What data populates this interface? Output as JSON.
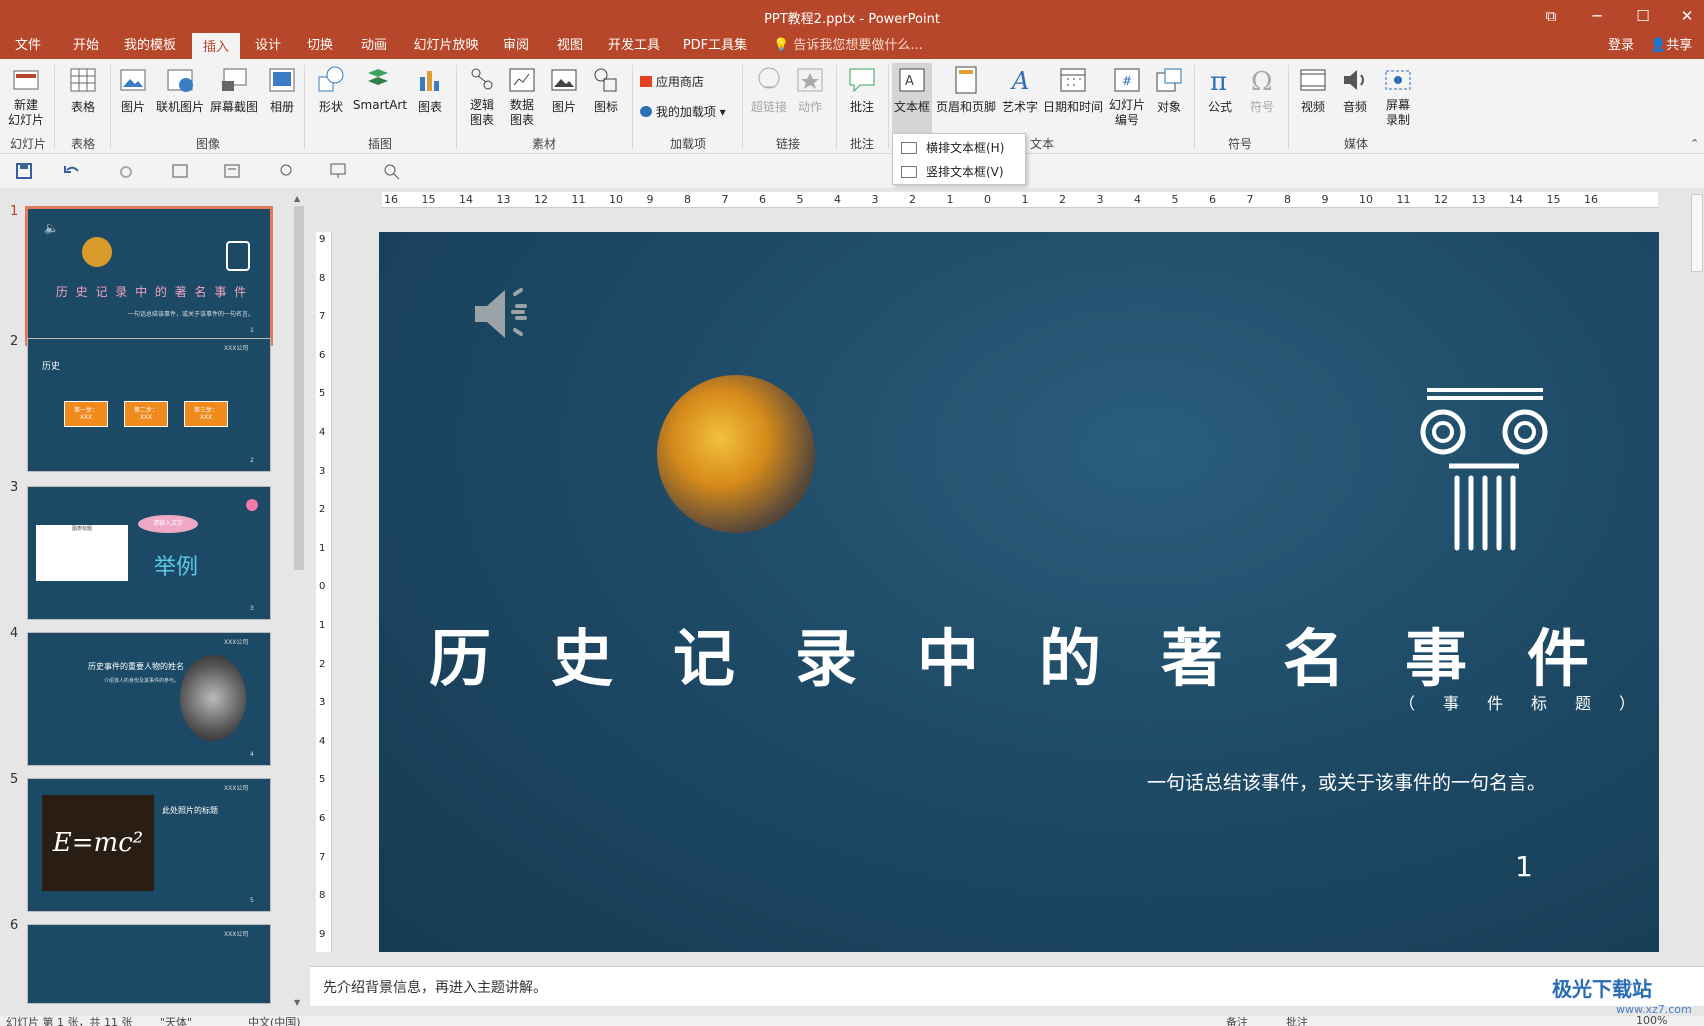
{
  "window": {
    "title": "PPT教程2.pptx - PowerPoint"
  },
  "tabs": [
    "文件",
    "开始",
    "我的模板",
    "插入",
    "设计",
    "切换",
    "动画",
    "幻灯片放映",
    "审阅",
    "视图",
    "开发工具",
    "PDF工具集"
  ],
  "active_tab": "插入",
  "tellme": "告诉我您想要做什么...",
  "account": {
    "login": "登录",
    "share": "共享"
  },
  "ribbon": {
    "buttons": {
      "new_slide": "新建\n幻灯片",
      "table": "表格",
      "picture": "图片",
      "online_picture": "联机图片",
      "screenshot": "屏幕截图",
      "album": "相册",
      "shapes": "形状",
      "smartart": "SmartArt",
      "chart": "图表",
      "logic_chart": "逻辑\n图表",
      "data_chart": "数据\n图表",
      "material_picture": "图片",
      "icon": "图标",
      "app_store": "应用商店",
      "my_addins": "我的加载项",
      "hyperlink": "超链接",
      "action": "动作",
      "comment": "批注",
      "textbox": "文本框",
      "header_footer": "页眉和页脚",
      "wordart": "艺术字",
      "datetime": "日期和时间",
      "slide_number": "幻灯片\n编号",
      "object": "对象",
      "equation": "公式",
      "symbol": "符号",
      "video": "视频",
      "audio": "音频",
      "screen_record": "屏幕\n录制"
    },
    "groups": {
      "slides": "幻灯片",
      "tables": "表格",
      "images": "图像",
      "illustrations": "插图",
      "material": "素材",
      "addins": "加载项",
      "links": "链接",
      "comments": "批注",
      "text": "文本",
      "symbols": "符号",
      "media": "媒体"
    }
  },
  "textbox_menu": {
    "horizontal": "横排文本框(H)",
    "vertical": "竖排文本框(V)"
  },
  "thumbnails": [
    {
      "num": "1",
      "title": "历 史 记 录 中 的 著 名 事 件",
      "caption": "一句话总结该事件，或关于该事件的一句名言。",
      "page": "1"
    },
    {
      "num": "2",
      "heading": "历史",
      "steps": [
        "第一步：",
        "第二步：",
        "第三步："
      ],
      "step_sub": "XXX",
      "page": "2",
      "brand": "XXX公司"
    },
    {
      "num": "3",
      "bubble": "请输入文字",
      "big": "举例",
      "chart_title": "图表标题",
      "page": "3"
    },
    {
      "num": "4",
      "heading": "历史事件的重要人物的姓名",
      "sub": "介绍该人的身份及其事件的参与。",
      "page": "4",
      "brand": "XXX公司"
    },
    {
      "num": "5",
      "heading": "此处照片的标题",
      "formula": "E=mc²",
      "page": "5",
      "brand": "XXX公司"
    },
    {
      "num": "6",
      "brand": "XXX公司"
    }
  ],
  "ruler": {
    "h_marks": [
      "16",
      "15",
      "14",
      "13",
      "12",
      "11",
      "10",
      "9",
      "8",
      "7",
      "6",
      "5",
      "4",
      "3",
      "2",
      "1",
      "0",
      "1",
      "2",
      "3",
      "4",
      "5",
      "6",
      "7",
      "8",
      "9",
      "10",
      "11",
      "12",
      "13",
      "14",
      "15",
      "16"
    ],
    "v_marks": [
      "9",
      "8",
      "7",
      "6",
      "5",
      "4",
      "3",
      "2",
      "1",
      "0",
      "1",
      "2",
      "3",
      "4",
      "5",
      "6",
      "7",
      "8",
      "9"
    ]
  },
  "slide": {
    "title": "历史记录中的著名事件",
    "subtitle": "（事件标题）",
    "quote": "一句话总结该事件，或关于该事件的一句名言。",
    "page_number": "1"
  },
  "notes": "先介绍背景信息，再进入主题讲解。",
  "status": {
    "left": "幻灯片 第 1 张，共 11 张",
    "theme": "\"天体\"",
    "lang": "中文(中国)",
    "notes": "备注",
    "comments": "批注",
    "zoom": "100%"
  },
  "watermark": {
    "line1": "极光下载站",
    "line2": "www.xz7.com"
  },
  "colors": {
    "accent": "#b7472a",
    "slide_bg": "#1e4a66"
  }
}
